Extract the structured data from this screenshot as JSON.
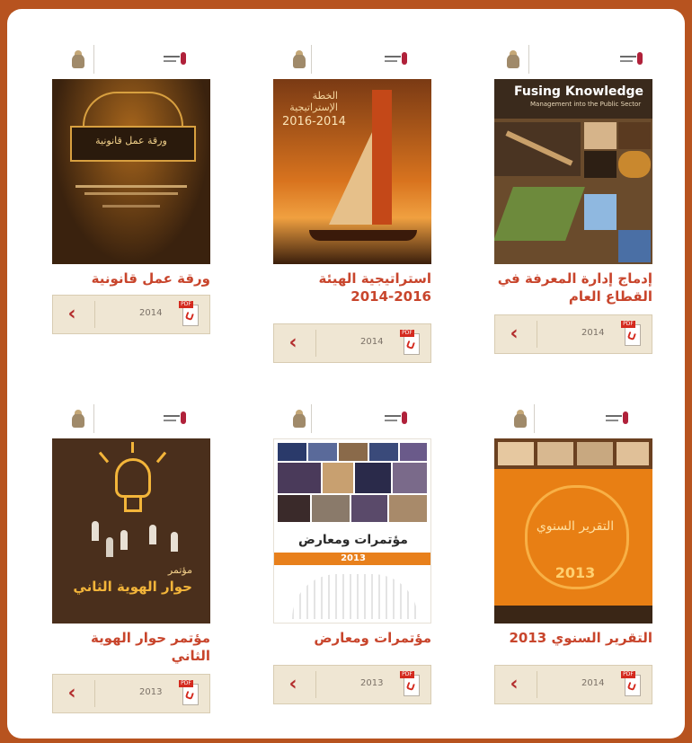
{
  "publications": [
    {
      "title": "إدماج إدارة المعرفة في القطاع العام",
      "year": "2014",
      "pdf_label": "PDF",
      "cover": {
        "heading": "Fusing Knowledge",
        "subheading": "Management into the Public Sector",
        "background": "#3a2a1c",
        "accent": "#8f5a28"
      }
    },
    {
      "title": "استراتيجية الهيئة 2016-2014",
      "year": "2014",
      "pdf_label": "PDF",
      "cover": {
        "heading": "الخطة الإستراتيجية",
        "subheading": "2016-2014",
        "background": "#c25a1a",
        "accent": "#f2a23a"
      }
    },
    {
      "title": "ورقة عمل قانونية",
      "year": "2014",
      "pdf_label": "PDF",
      "cover": {
        "heading": "ورقة عمل قانونية",
        "background": "#2b1b0e",
        "accent": "#d49a3a"
      }
    },
    {
      "title": "التقرير السنوي 2013",
      "year": "2014",
      "pdf_label": "PDF",
      "cover": {
        "heading": "التقرير السنوي",
        "subheading": "2013",
        "background": "#e87f14",
        "accent": "#ffc45a"
      }
    },
    {
      "title": "مؤتمرات ومعارض",
      "year": "2013",
      "pdf_label": "PDF",
      "cover": {
        "heading": "مؤتمرات ومعارض",
        "subheading": "2013",
        "background": "#ffffff",
        "accent": "#e8801c"
      }
    },
    {
      "title": "مؤتمر حوار الهوية الثاني",
      "year": "2013",
      "pdf_label": "PDF",
      "cover": {
        "heading": "مؤتمر",
        "subheading": "حوار الهوية الثاني",
        "background": "#4a2f1c",
        "accent": "#f3b53a"
      }
    }
  ]
}
